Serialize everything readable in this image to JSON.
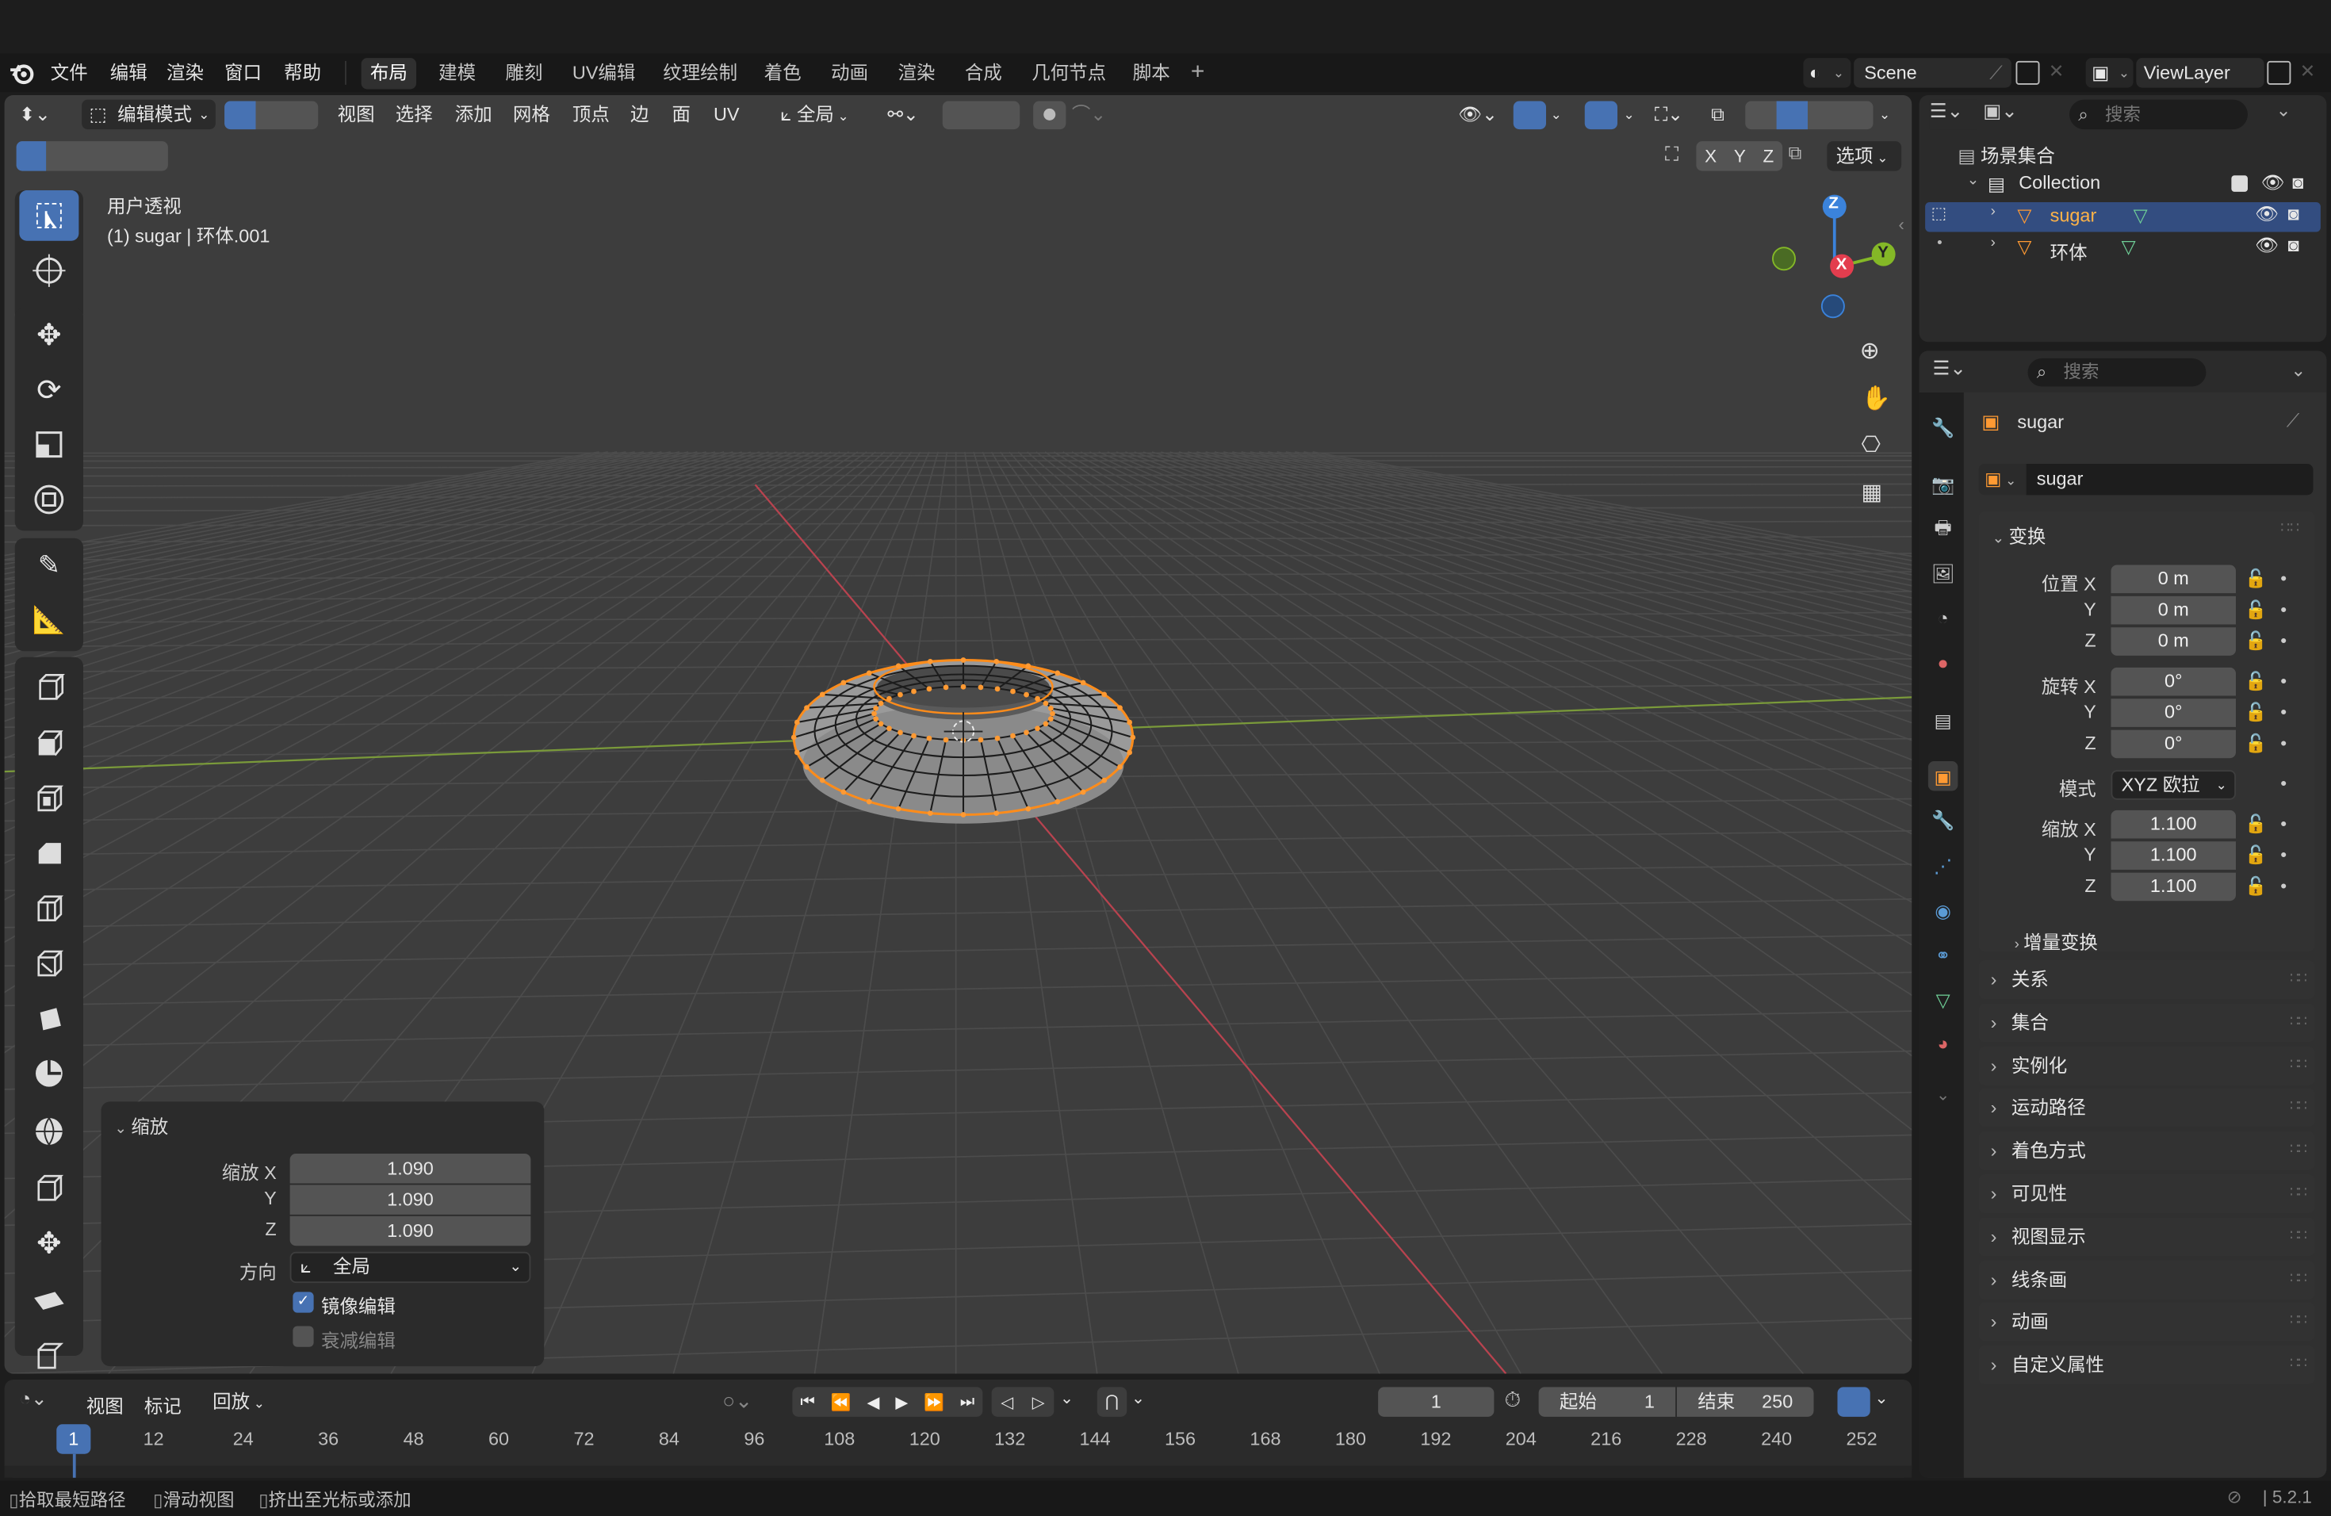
{
  "top_menu": {
    "items": [
      "文件",
      "编辑",
      "渲染",
      "窗口",
      "帮助"
    ],
    "workspaces": [
      "布局",
      "建模",
      "雕刻",
      "UV编辑",
      "纹理绘制",
      "着色",
      "动画",
      "渲染",
      "合成",
      "几何节点",
      "脚本"
    ],
    "active_workspace": "布局",
    "scene": "Scene",
    "view_layer": "ViewLayer"
  },
  "viewport_header": {
    "mode": "编辑模式",
    "menus": [
      "视图",
      "选择",
      "添加",
      "网格",
      "顶点",
      "边",
      "面",
      "UV"
    ],
    "orientation": "全局",
    "axes": [
      "X",
      "Y",
      "Z"
    ],
    "options": "选项"
  },
  "viewport": {
    "view_name": "用户透视",
    "object_info": "(1) sugar | 环体.001",
    "gizmo_axes": {
      "z": "Z",
      "x": "X",
      "y": "Y"
    }
  },
  "tools": [
    "select-box",
    "cursor",
    "move",
    "rotate",
    "scale",
    "transform",
    "annotate",
    "measure",
    "add-cube",
    "extrude",
    "inset",
    "bevel",
    "loop-cut",
    "knife",
    "poly-build",
    "spin",
    "smooth",
    "edge-slide",
    "shrink-fatten",
    "shear",
    "rip-region"
  ],
  "operator_panel": {
    "title": "缩放",
    "rows": [
      {
        "label": "缩放 X",
        "value": "1.090"
      },
      {
        "label": "Y",
        "value": "1.090"
      },
      {
        "label": "Z",
        "value": "1.090"
      }
    ],
    "orientation_label": "方向",
    "orientation_value": "全局",
    "mirror_edit": "镜像编辑",
    "mirror_checked": true,
    "proportional_edit": "衰减编辑",
    "proportional_checked": false
  },
  "outliner": {
    "search_placeholder": "搜索",
    "root": "场景集合",
    "collection": "Collection",
    "objects": [
      {
        "name": "sugar",
        "selected": true
      },
      {
        "name": "环体",
        "selected": false
      }
    ]
  },
  "properties": {
    "search_placeholder": "搜索",
    "object_name": "sugar",
    "datablock_name": "sugar",
    "transform_title": "变换",
    "location": {
      "label": "位置 X",
      "x": "0 m",
      "y": "0 m",
      "z": "0 m"
    },
    "rotation": {
      "label": "旋转 X",
      "x": "0°",
      "y": "0°",
      "z": "0°"
    },
    "rotation_mode_label": "模式",
    "rotation_mode": "XYZ 欧拉",
    "scale": {
      "label": "缩放 X",
      "x": "1.100",
      "y": "1.100",
      "z": "1.100"
    },
    "axis_y": "Y",
    "axis_z": "Z",
    "delta_transform": "增量变换",
    "sections": [
      "关系",
      "集合",
      "实例化",
      "运动路径",
      "着色方式",
      "可见性",
      "视图显示",
      "线条画",
      "动画",
      "自定义属性"
    ]
  },
  "timeline": {
    "menus": [
      "视图",
      "标记"
    ],
    "playback": "回放",
    "current_frame": "1",
    "start_label": "起始",
    "start": "1",
    "end_label": "结束",
    "end": "250",
    "ticks": [
      "1",
      "12",
      "24",
      "36",
      "48",
      "60",
      "72",
      "84",
      "96",
      "108",
      "120",
      "132",
      "144",
      "156",
      "168",
      "180",
      "192",
      "204",
      "216",
      "228",
      "240",
      "252"
    ]
  },
  "status_bar": {
    "items": [
      "拾取最短路径",
      "滑动视图",
      "挤出至光标或添加"
    ],
    "version": "5.2.1"
  },
  "colors": {
    "accent": "#4772b3",
    "selected_orange": "#ff8c1a",
    "x_axis": "#e33d4e",
    "y_axis": "#84b827",
    "z_axis": "#3b83db"
  }
}
